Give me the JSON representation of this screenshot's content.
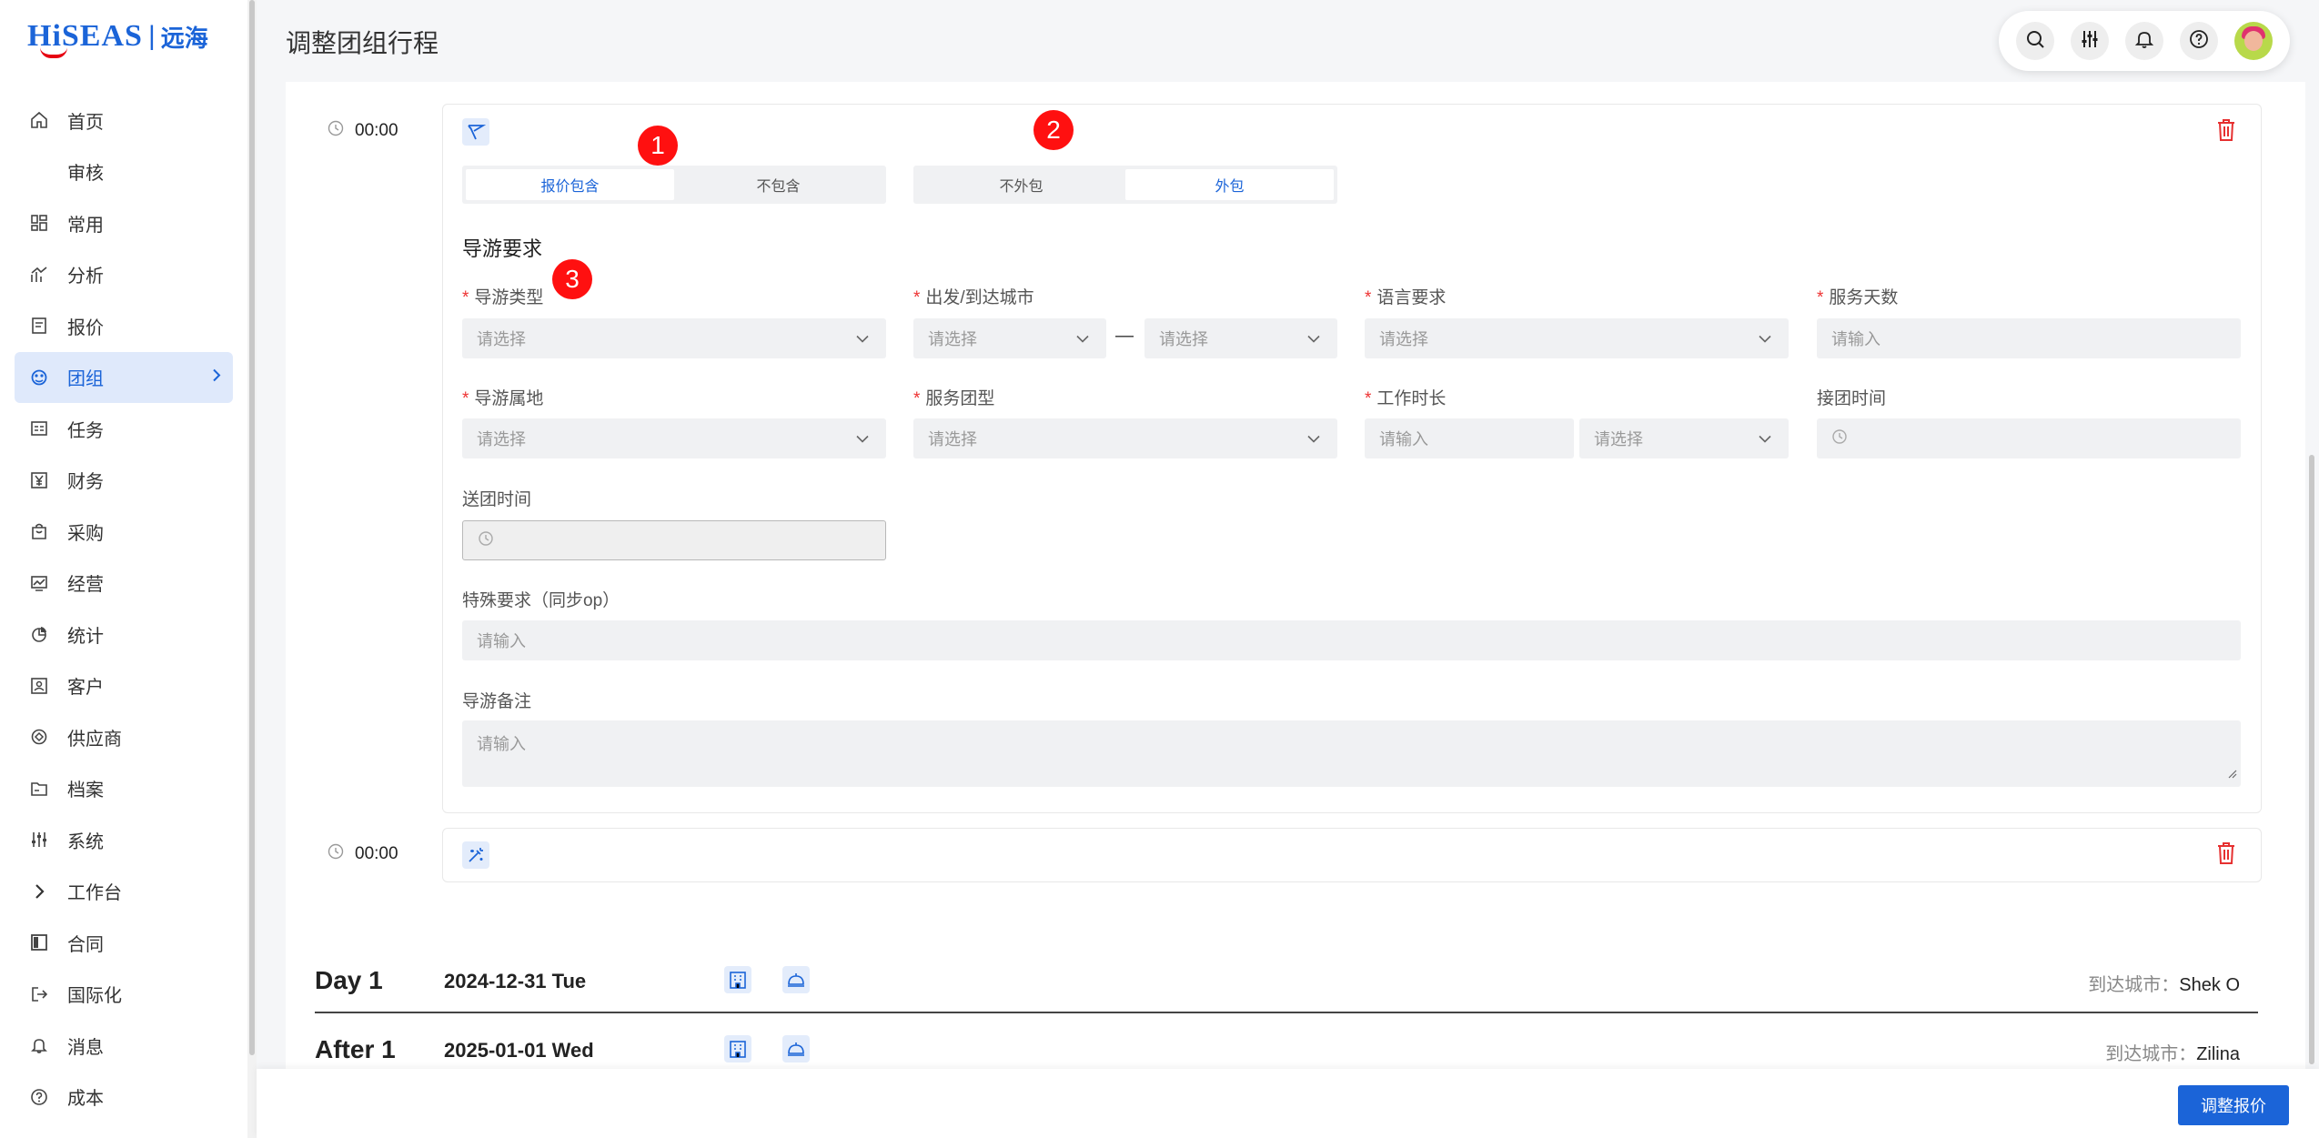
{
  "app": {
    "logo_text": "HiSEAS",
    "logo_sep": "|",
    "logo_cn": "远海"
  },
  "sidebar": {
    "items": [
      {
        "label": "首页",
        "icon": "home-icon"
      },
      {
        "label": "审核",
        "icon": ""
      },
      {
        "label": "常用",
        "icon": "grid-icon"
      },
      {
        "label": "分析",
        "icon": "analytics-icon"
      },
      {
        "label": "报价",
        "icon": "quote-icon"
      },
      {
        "label": "团组",
        "icon": "group-icon",
        "active": true
      },
      {
        "label": "任务",
        "icon": "task-icon"
      },
      {
        "label": "财务",
        "icon": "finance-icon"
      },
      {
        "label": "采购",
        "icon": "purchase-icon"
      },
      {
        "label": "经营",
        "icon": "operation-icon"
      },
      {
        "label": "统计",
        "icon": "pie-icon"
      },
      {
        "label": "客户",
        "icon": "customer-icon"
      },
      {
        "label": "供应商",
        "icon": "supplier-icon"
      },
      {
        "label": "档案",
        "icon": "folder-icon"
      },
      {
        "label": "系统",
        "icon": "sliders-icon"
      },
      {
        "label": "工作台",
        "icon": "chevron-right-icon"
      },
      {
        "label": "合同",
        "icon": "contract-icon"
      },
      {
        "label": "国际化",
        "icon": "logout-icon"
      },
      {
        "label": "消息",
        "icon": "bell-icon"
      },
      {
        "label": "成本",
        "icon": "help-circle-icon"
      }
    ],
    "active_color": "#1b64d8"
  },
  "header": {
    "title": "调整团组行程",
    "tools": [
      "search-icon",
      "sliders-icon",
      "bell-icon",
      "help-icon",
      "avatar"
    ]
  },
  "activity1": {
    "time": "00:00",
    "seg1": {
      "options": [
        "报价包含",
        "不包含"
      ],
      "selected": "报价包含"
    },
    "seg2": {
      "options": [
        "不外包",
        "外包"
      ],
      "selected": "外包"
    },
    "badges": [
      "1",
      "2",
      "3"
    ],
    "section_title": "导游要求",
    "fields": {
      "guide_type": {
        "label": "导游类型",
        "required": true,
        "placeholder": "请选择"
      },
      "city": {
        "label": "出发/到达城市",
        "required": true,
        "placeholder_from": "请选择",
        "placeholder_to": "请选择",
        "separator": "—"
      },
      "language": {
        "label": "语言要求",
        "required": true,
        "placeholder": "请选择"
      },
      "service_days": {
        "label": "服务天数",
        "required": false,
        "placeholder": "请输入"
      },
      "guide_location": {
        "label": "导游属地",
        "required": true,
        "placeholder": "请选择"
      },
      "service_group_type": {
        "label": "服务团型",
        "required": true,
        "placeholder": "请选择"
      },
      "work_hours": {
        "label": "工作时长",
        "required": true,
        "placeholder_value": "请输入",
        "placeholder_unit": "请选择"
      },
      "pickup_time": {
        "label": "接团时间",
        "required": false
      },
      "dropoff_time": {
        "label": "送团时间",
        "required": false
      },
      "special_requirements": {
        "label": "特殊要求（同步op）",
        "placeholder": "请输入"
      },
      "guide_notes": {
        "label": "导游备注",
        "placeholder": "请输入"
      }
    }
  },
  "activity2": {
    "time": "00:00"
  },
  "days": [
    {
      "name": "Day 1",
      "date": "2024-12-31 Tue",
      "city_label": "到达城市：",
      "city": "Shek O"
    },
    {
      "name": "After 1",
      "date": "2025-01-01 Wed",
      "city_label": "到达城市：",
      "city": "Zilina"
    }
  ],
  "footer": {
    "primary_button": "调整报价"
  },
  "colors": {
    "accent": "#1b64d8",
    "danger": "#e63030",
    "badge": "#ff1010"
  }
}
